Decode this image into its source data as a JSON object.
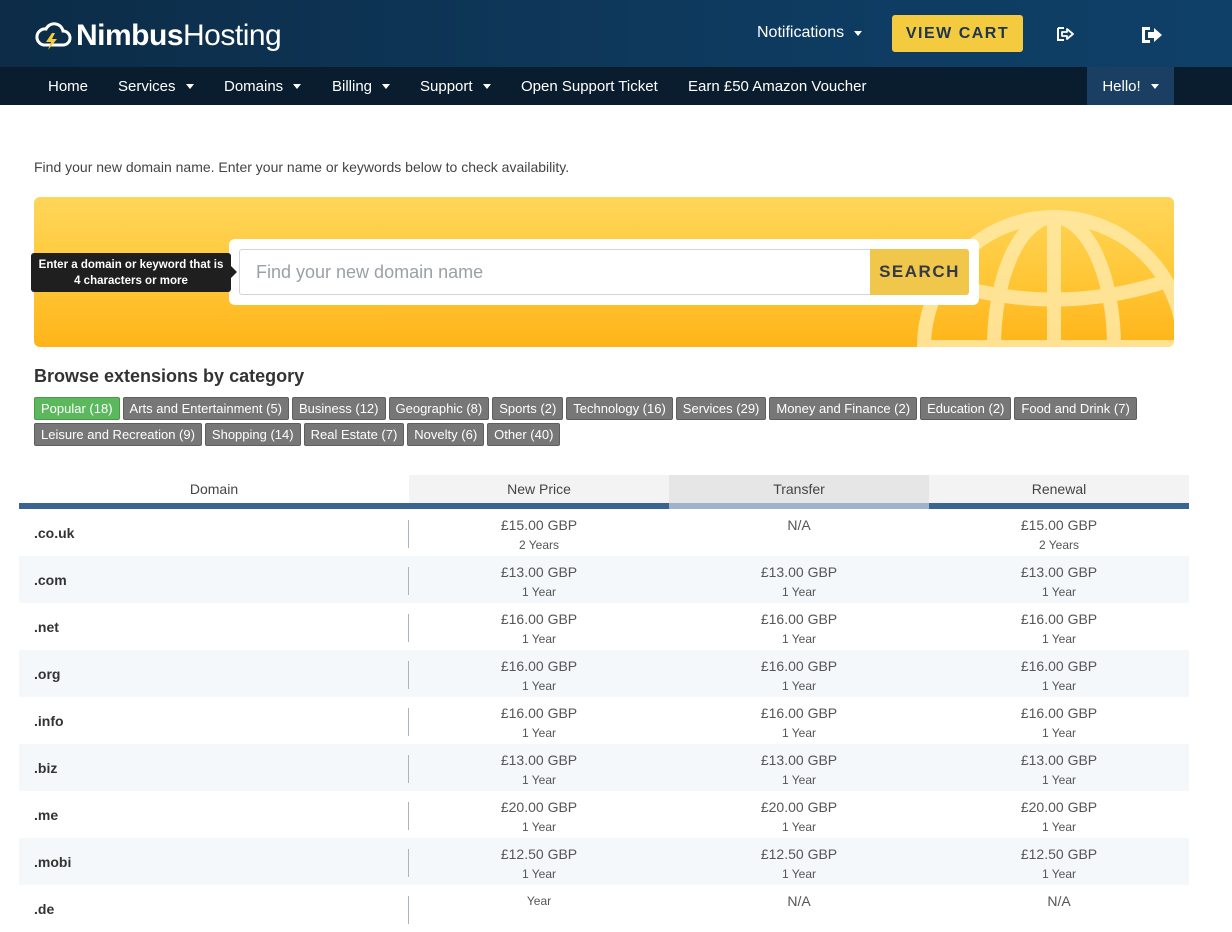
{
  "brand": {
    "bold": "Nimbus",
    "light": "Hosting"
  },
  "header": {
    "notifications_label": "Notifications",
    "cart_label": "VIEW CART"
  },
  "nav": {
    "items": [
      {
        "label": "Home",
        "dropdown": false
      },
      {
        "label": "Services",
        "dropdown": true
      },
      {
        "label": "Domains",
        "dropdown": true
      },
      {
        "label": "Billing",
        "dropdown": true
      },
      {
        "label": "Support",
        "dropdown": true
      },
      {
        "label": "Open Support Ticket",
        "dropdown": false
      },
      {
        "label": "Earn £50 Amazon Voucher",
        "dropdown": false
      }
    ],
    "user_label": "Hello!"
  },
  "intro_text": "Find your new domain name. Enter your name or keywords below to check availability.",
  "search": {
    "placeholder": "Find your new domain name",
    "button_label": "SEARCH",
    "tooltip_line1": "Enter a domain or keyword that is",
    "tooltip_line2": "4 characters or more"
  },
  "categories": {
    "title": "Browse extensions by category",
    "items": [
      {
        "label": "Popular (18)",
        "active": true
      },
      {
        "label": "Arts and Entertainment (5)",
        "active": false
      },
      {
        "label": "Business (12)",
        "active": false
      },
      {
        "label": "Geographic (8)",
        "active": false
      },
      {
        "label": "Sports (2)",
        "active": false
      },
      {
        "label": "Technology (16)",
        "active": false
      },
      {
        "label": "Services (29)",
        "active": false
      },
      {
        "label": "Money and Finance (2)",
        "active": false
      },
      {
        "label": "Education (2)",
        "active": false
      },
      {
        "label": "Food and Drink (7)",
        "active": false
      },
      {
        "label": "Leisure and Recreation (9)",
        "active": false
      },
      {
        "label": "Shopping (14)",
        "active": false
      },
      {
        "label": "Real Estate (7)",
        "active": false
      },
      {
        "label": "Novelty (6)",
        "active": false
      },
      {
        "label": "Other (40)",
        "active": false
      }
    ]
  },
  "table": {
    "headers": [
      "Domain",
      "New Price",
      "Transfer",
      "Renewal"
    ],
    "rows": [
      {
        "domain": ".co.uk",
        "new_price": "£15.00 GBP",
        "new_term": "2 Years",
        "transfer": "N/A",
        "transfer_term": "",
        "renewal": "£15.00 GBP",
        "renewal_term": "2 Years"
      },
      {
        "domain": ".com",
        "new_price": "£13.00 GBP",
        "new_term": "1 Year",
        "transfer": "£13.00 GBP",
        "transfer_term": "1 Year",
        "renewal": "£13.00 GBP",
        "renewal_term": "1 Year"
      },
      {
        "domain": ".net",
        "new_price": "£16.00 GBP",
        "new_term": "1 Year",
        "transfer": "£16.00 GBP",
        "transfer_term": "1 Year",
        "renewal": "£16.00 GBP",
        "renewal_term": "1 Year"
      },
      {
        "domain": ".org",
        "new_price": "£16.00 GBP",
        "new_term": "1 Year",
        "transfer": "£16.00 GBP",
        "transfer_term": "1 Year",
        "renewal": "£16.00 GBP",
        "renewal_term": "1 Year"
      },
      {
        "domain": ".info",
        "new_price": "£16.00 GBP",
        "new_term": "1 Year",
        "transfer": "£16.00 GBP",
        "transfer_term": "1 Year",
        "renewal": "£16.00 GBP",
        "renewal_term": "1 Year"
      },
      {
        "domain": ".biz",
        "new_price": "£13.00 GBP",
        "new_term": "1 Year",
        "transfer": "£13.00 GBP",
        "transfer_term": "1 Year",
        "renewal": "£13.00 GBP",
        "renewal_term": "1 Year"
      },
      {
        "domain": ".me",
        "new_price": "£20.00 GBP",
        "new_term": "1 Year",
        "transfer": "£20.00 GBP",
        "transfer_term": "1 Year",
        "renewal": "£20.00 GBP",
        "renewal_term": "1 Year"
      },
      {
        "domain": ".mobi",
        "new_price": "£12.50 GBP",
        "new_term": "1 Year",
        "transfer": "£12.50 GBP",
        "transfer_term": "1 Year",
        "renewal": "£12.50 GBP",
        "renewal_term": "1 Year"
      },
      {
        "domain": ".de",
        "new_price": "",
        "new_term": "Year",
        "transfer": "N/A",
        "transfer_term": "",
        "renewal": "N/A",
        "renewal_term": ""
      }
    ]
  },
  "colors": {
    "header_bg": "#0e3a5f",
    "nav_bg": "#0a1d2f",
    "cart_button": "#f4ca3e",
    "active_category": "#5cb85c",
    "category": "#777777",
    "table_header_bar": "#3a6591",
    "transfer_header_bar": "#9fb4cc"
  },
  "icons": {
    "logo": "cloud-lightning-icon",
    "login_out": "sign-in-icon",
    "logout": "sign-out-icon",
    "banner_globe": "globe-icon"
  }
}
